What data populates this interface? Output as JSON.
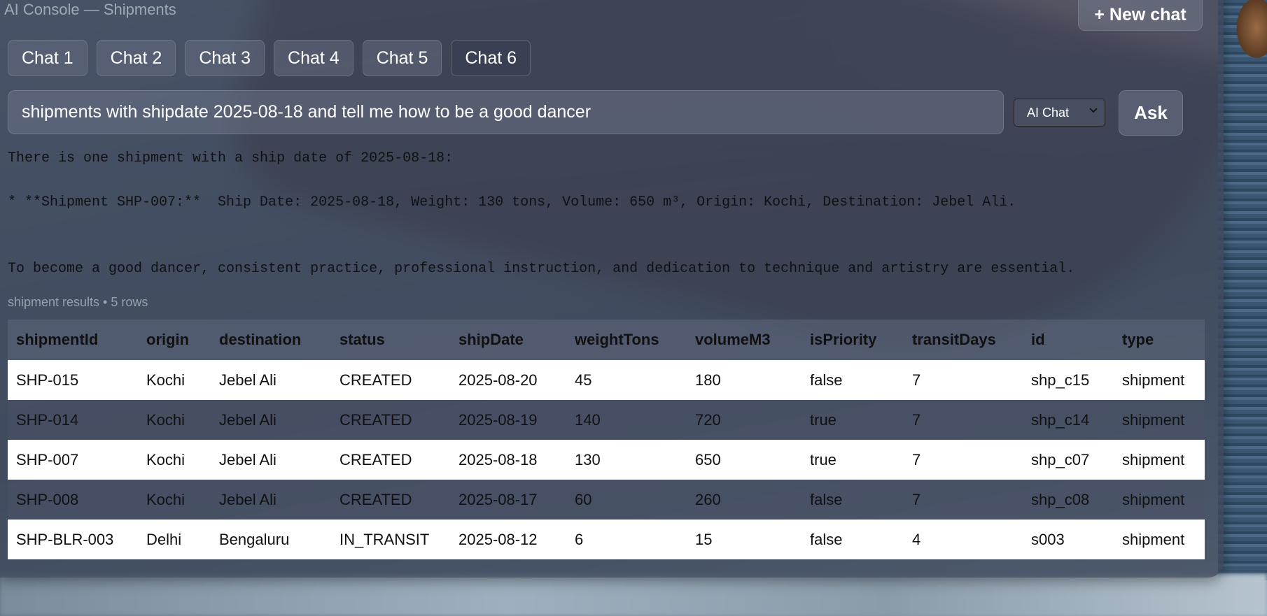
{
  "app": {
    "title": "AI Console — Shipments",
    "new_chat_label": "+ New chat"
  },
  "tabs": [
    "Chat 1",
    "Chat 2",
    "Chat 3",
    "Chat 4",
    "Chat 5",
    "Chat 6"
  ],
  "active_tab": "Chat 6",
  "query": {
    "value": "shipments with shipdate 2025-08-18 and tell me how to be a good dancer"
  },
  "mode": {
    "selected": "AI Chat"
  },
  "ask_label": "Ask",
  "answer": {
    "line1": "There is one shipment with a ship date of 2025-08-18:",
    "line2": "* **Shipment SHP-007:**  Ship Date: 2025-08-18, Weight: 130 tons, Volume: 650 m³, Origin: Kochi, Destination: Jebel Ali.",
    "line3": "To become a good dancer, consistent practice, professional instruction, and dedication to technique and artistry are essential."
  },
  "results": {
    "meta": "shipment results • 5 rows",
    "columns": [
      "shipmentId",
      "origin",
      "destination",
      "status",
      "shipDate",
      "weightTons",
      "volumeM3",
      "isPriority",
      "transitDays",
      "id",
      "type"
    ],
    "rows": [
      [
        "SHP-015",
        "Kochi",
        "Jebel Ali",
        "CREATED",
        "2025-08-20",
        "45",
        "180",
        "false",
        "7",
        "shp_c15",
        "shipment"
      ],
      [
        "SHP-014",
        "Kochi",
        "Jebel Ali",
        "CREATED",
        "2025-08-19",
        "140",
        "720",
        "true",
        "7",
        "shp_c14",
        "shipment"
      ],
      [
        "SHP-007",
        "Kochi",
        "Jebel Ali",
        "CREATED",
        "2025-08-18",
        "130",
        "650",
        "true",
        "7",
        "shp_c07",
        "shipment"
      ],
      [
        "SHP-008",
        "Kochi",
        "Jebel Ali",
        "CREATED",
        "2025-08-17",
        "60",
        "260",
        "false",
        "7",
        "shp_c08",
        "shipment"
      ],
      [
        "SHP-BLR-003",
        "Delhi",
        "Bengaluru",
        "IN_TRANSIT",
        "2025-08-12",
        "6",
        "15",
        "false",
        "4",
        "s003",
        "shipment"
      ]
    ]
  }
}
